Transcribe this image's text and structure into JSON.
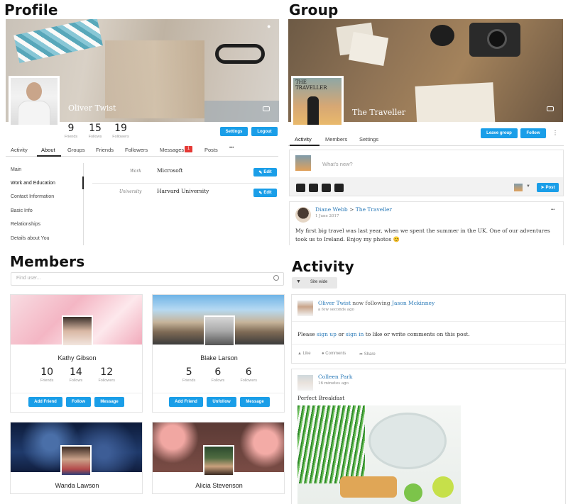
{
  "sections": {
    "profile": "Profile",
    "group": "Group",
    "members": "Members",
    "activity": "Activity"
  },
  "profile": {
    "name": "Oliver Twist",
    "stats": [
      {
        "value": "9",
        "label": "Friends"
      },
      {
        "value": "15",
        "label": "Follows"
      },
      {
        "value": "19",
        "label": "Followers"
      }
    ],
    "buttons": {
      "settings": "Settings",
      "logout": "Logout"
    },
    "tabs": [
      "Activity",
      "About",
      "Groups",
      "Friends",
      "Followers",
      "Messages",
      "Posts",
      "•••"
    ],
    "messages_badge": "1",
    "side_menu": [
      "Main",
      "Work and Education",
      "Contact Information",
      "Basic Info",
      "Relationships",
      "Details about You"
    ],
    "fields": [
      {
        "label": "Work",
        "value": "Microsoft",
        "edit": "Edit"
      },
      {
        "label": "University",
        "value": "Harvard University",
        "edit": "Edit"
      }
    ]
  },
  "group": {
    "name": "The Traveller",
    "avatar_text": "THE TRAVELLER",
    "buttons": {
      "leave": "Leave group",
      "follow": "Follow",
      "more": "⋮"
    },
    "tabs": [
      "Activity",
      "Members",
      "Settings"
    ],
    "composer_placeholder": "What's new?",
    "post_button": "Post",
    "post": {
      "author": "Diane Webb",
      "separator": ">",
      "target": "The Traveller",
      "date": "1 June 2017",
      "more": "•••",
      "text": "My first big travel was last year, when we spent the summer in the UK. One of our adventures took us to Ireland. Enjoy my photos 😊"
    }
  },
  "members": {
    "search_placeholder": "Find user...",
    "cards": [
      {
        "name": "Kathy Gibson",
        "stats": [
          {
            "value": "10",
            "label": "Friends"
          },
          {
            "value": "14",
            "label": "Follows"
          },
          {
            "value": "12",
            "label": "Followers"
          }
        ],
        "buttons": [
          "Add Friend",
          "Follow",
          "Message"
        ]
      },
      {
        "name": "Blake Larson",
        "stats": [
          {
            "value": "5",
            "label": "Friends"
          },
          {
            "value": "6",
            "label": "Follows"
          },
          {
            "value": "6",
            "label": "Followers"
          }
        ],
        "buttons": [
          "Add Friend",
          "Unfollow",
          "Message"
        ]
      },
      {
        "name": "Wanda Lawson"
      },
      {
        "name": "Alicia Stevenson"
      }
    ]
  },
  "activity": {
    "filter_label": "Site wide",
    "items": [
      {
        "author": "Oliver Twist",
        "action": "now following",
        "target": "Jason Mckinney",
        "time": "a few seconds ago",
        "prompt_pre": "Please",
        "prompt_signup": "sign up",
        "prompt_or": "or",
        "prompt_signin": "sign in",
        "prompt_post": "to like or write comments on this post.",
        "actions": [
          "Like",
          "Comments",
          "Share"
        ]
      },
      {
        "author": "Colleen Park",
        "time": "16 minutes ago",
        "text": "Perfect Breakfast"
      }
    ]
  },
  "colors": {
    "accent": "#1a9ee8",
    "link": "#2a7ab8",
    "badge": "#e53935"
  }
}
